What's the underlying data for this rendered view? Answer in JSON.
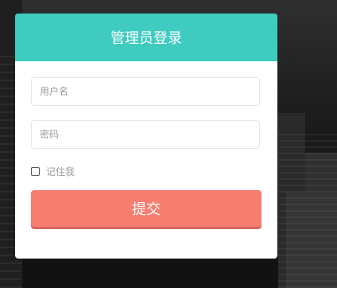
{
  "header": {
    "title": "管理员登录"
  },
  "form": {
    "username_placeholder": "用户名",
    "password_placeholder": "密码",
    "remember_label": "记住我",
    "remember_checked": false,
    "submit_label": "提交"
  },
  "colors": {
    "header_bg": "#3fcbc0",
    "button_bg": "#f67d6f",
    "card_bg": "#ffffff"
  }
}
